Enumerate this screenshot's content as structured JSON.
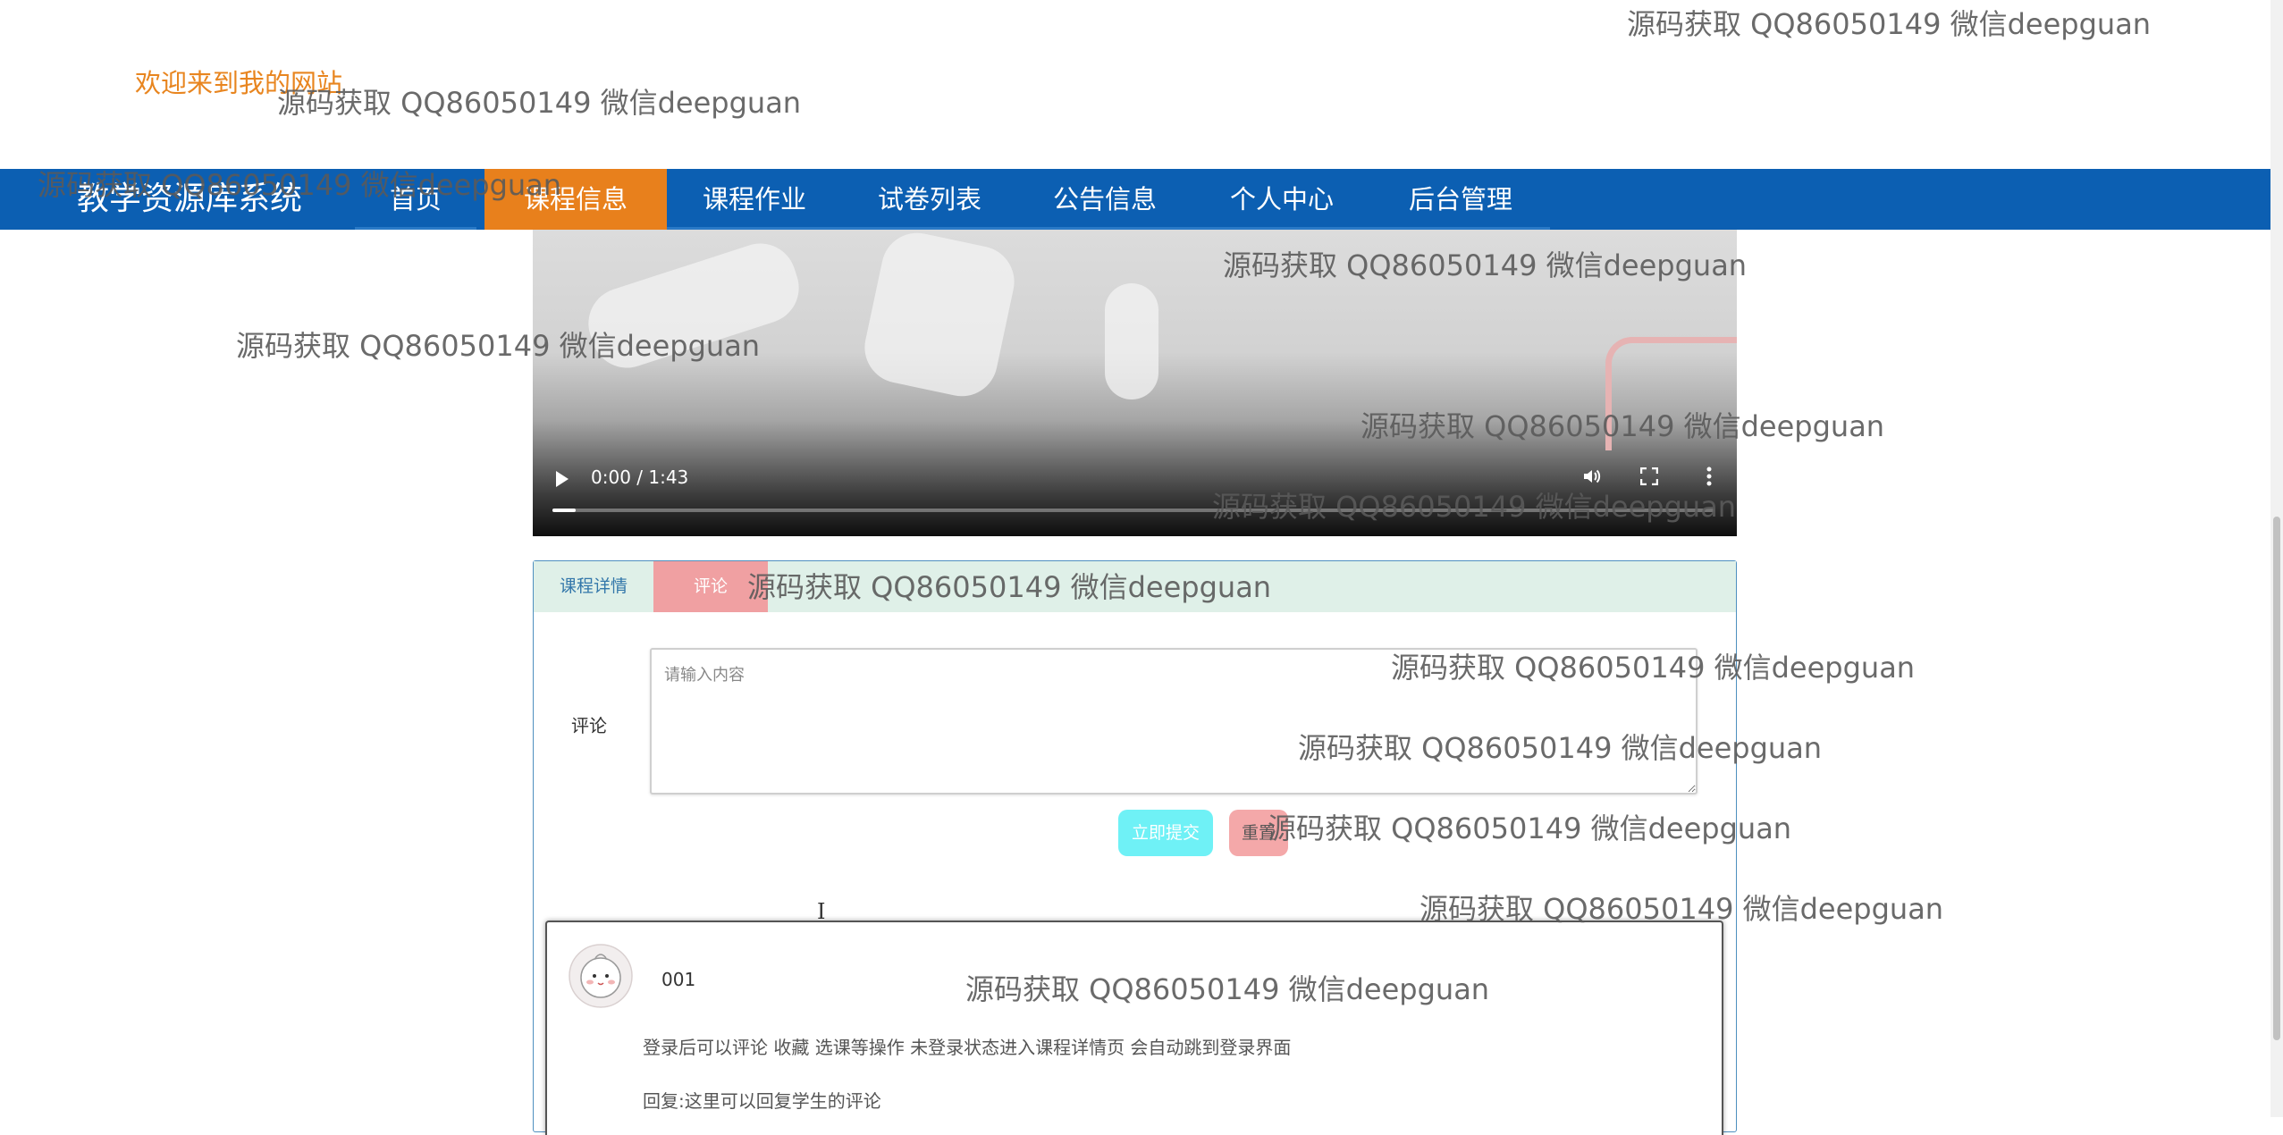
{
  "header": {
    "welcome": "欢迎来到我的网站"
  },
  "nav": {
    "brand": "教学资源库系统",
    "items": [
      {
        "label": "首页"
      },
      {
        "label": "课程信息"
      },
      {
        "label": "课程作业"
      },
      {
        "label": "试卷列表"
      },
      {
        "label": "公告信息"
      },
      {
        "label": "个人中心"
      },
      {
        "label": "后台管理"
      }
    ],
    "active": "课程信息"
  },
  "video": {
    "time": "0:00 / 1:43",
    "progress_fraction": 0.02
  },
  "tabs": {
    "detail": "课程详情",
    "comment": "评论"
  },
  "comment_form": {
    "label": "评论",
    "placeholder": "请输入内容",
    "submit": "立即提交",
    "reset": "重置"
  },
  "comments": [
    {
      "user": "001",
      "text": "登录后可以评论 收藏 选课等操作 未登录状态进入课程详情页 会自动跳到登录界面",
      "reply": "回复:这里可以回复学生的评论"
    }
  ],
  "watermark": "源码获取 QQ86050149 微信deepguan",
  "colors": {
    "nav": "#0c5fb2",
    "active": "#e8801c",
    "welcome": "#e8851f",
    "submit": "#6ff1f6",
    "reset": "#f4a8a9"
  }
}
